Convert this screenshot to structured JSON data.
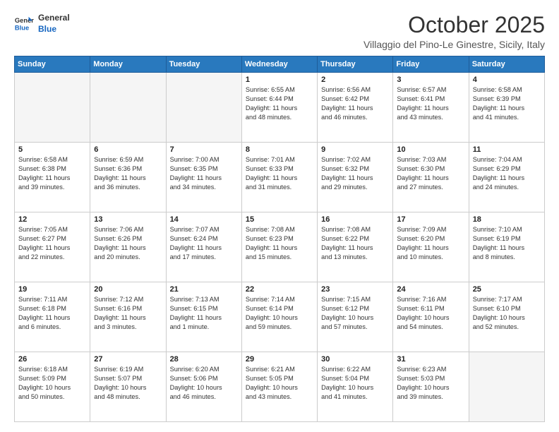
{
  "logo": {
    "line1": "General",
    "line2": "Blue"
  },
  "header": {
    "month": "October 2025",
    "location": "Villaggio del Pino-Le Ginestre, Sicily, Italy"
  },
  "weekdays": [
    "Sunday",
    "Monday",
    "Tuesday",
    "Wednesday",
    "Thursday",
    "Friday",
    "Saturday"
  ],
  "weeks": [
    [
      {
        "day": "",
        "text": ""
      },
      {
        "day": "",
        "text": ""
      },
      {
        "day": "",
        "text": ""
      },
      {
        "day": "1",
        "text": "Sunrise: 6:55 AM\nSunset: 6:44 PM\nDaylight: 11 hours\nand 48 minutes."
      },
      {
        "day": "2",
        "text": "Sunrise: 6:56 AM\nSunset: 6:42 PM\nDaylight: 11 hours\nand 46 minutes."
      },
      {
        "day": "3",
        "text": "Sunrise: 6:57 AM\nSunset: 6:41 PM\nDaylight: 11 hours\nand 43 minutes."
      },
      {
        "day": "4",
        "text": "Sunrise: 6:58 AM\nSunset: 6:39 PM\nDaylight: 11 hours\nand 41 minutes."
      }
    ],
    [
      {
        "day": "5",
        "text": "Sunrise: 6:58 AM\nSunset: 6:38 PM\nDaylight: 11 hours\nand 39 minutes."
      },
      {
        "day": "6",
        "text": "Sunrise: 6:59 AM\nSunset: 6:36 PM\nDaylight: 11 hours\nand 36 minutes."
      },
      {
        "day": "7",
        "text": "Sunrise: 7:00 AM\nSunset: 6:35 PM\nDaylight: 11 hours\nand 34 minutes."
      },
      {
        "day": "8",
        "text": "Sunrise: 7:01 AM\nSunset: 6:33 PM\nDaylight: 11 hours\nand 31 minutes."
      },
      {
        "day": "9",
        "text": "Sunrise: 7:02 AM\nSunset: 6:32 PM\nDaylight: 11 hours\nand 29 minutes."
      },
      {
        "day": "10",
        "text": "Sunrise: 7:03 AM\nSunset: 6:30 PM\nDaylight: 11 hours\nand 27 minutes."
      },
      {
        "day": "11",
        "text": "Sunrise: 7:04 AM\nSunset: 6:29 PM\nDaylight: 11 hours\nand 24 minutes."
      }
    ],
    [
      {
        "day": "12",
        "text": "Sunrise: 7:05 AM\nSunset: 6:27 PM\nDaylight: 11 hours\nand 22 minutes."
      },
      {
        "day": "13",
        "text": "Sunrise: 7:06 AM\nSunset: 6:26 PM\nDaylight: 11 hours\nand 20 minutes."
      },
      {
        "day": "14",
        "text": "Sunrise: 7:07 AM\nSunset: 6:24 PM\nDaylight: 11 hours\nand 17 minutes."
      },
      {
        "day": "15",
        "text": "Sunrise: 7:08 AM\nSunset: 6:23 PM\nDaylight: 11 hours\nand 15 minutes."
      },
      {
        "day": "16",
        "text": "Sunrise: 7:08 AM\nSunset: 6:22 PM\nDaylight: 11 hours\nand 13 minutes."
      },
      {
        "day": "17",
        "text": "Sunrise: 7:09 AM\nSunset: 6:20 PM\nDaylight: 11 hours\nand 10 minutes."
      },
      {
        "day": "18",
        "text": "Sunrise: 7:10 AM\nSunset: 6:19 PM\nDaylight: 11 hours\nand 8 minutes."
      }
    ],
    [
      {
        "day": "19",
        "text": "Sunrise: 7:11 AM\nSunset: 6:18 PM\nDaylight: 11 hours\nand 6 minutes."
      },
      {
        "day": "20",
        "text": "Sunrise: 7:12 AM\nSunset: 6:16 PM\nDaylight: 11 hours\nand 3 minutes."
      },
      {
        "day": "21",
        "text": "Sunrise: 7:13 AM\nSunset: 6:15 PM\nDaylight: 11 hours\nand 1 minute."
      },
      {
        "day": "22",
        "text": "Sunrise: 7:14 AM\nSunset: 6:14 PM\nDaylight: 10 hours\nand 59 minutes."
      },
      {
        "day": "23",
        "text": "Sunrise: 7:15 AM\nSunset: 6:12 PM\nDaylight: 10 hours\nand 57 minutes."
      },
      {
        "day": "24",
        "text": "Sunrise: 7:16 AM\nSunset: 6:11 PM\nDaylight: 10 hours\nand 54 minutes."
      },
      {
        "day": "25",
        "text": "Sunrise: 7:17 AM\nSunset: 6:10 PM\nDaylight: 10 hours\nand 52 minutes."
      }
    ],
    [
      {
        "day": "26",
        "text": "Sunrise: 6:18 AM\nSunset: 5:09 PM\nDaylight: 10 hours\nand 50 minutes."
      },
      {
        "day": "27",
        "text": "Sunrise: 6:19 AM\nSunset: 5:07 PM\nDaylight: 10 hours\nand 48 minutes."
      },
      {
        "day": "28",
        "text": "Sunrise: 6:20 AM\nSunset: 5:06 PM\nDaylight: 10 hours\nand 46 minutes."
      },
      {
        "day": "29",
        "text": "Sunrise: 6:21 AM\nSunset: 5:05 PM\nDaylight: 10 hours\nand 43 minutes."
      },
      {
        "day": "30",
        "text": "Sunrise: 6:22 AM\nSunset: 5:04 PM\nDaylight: 10 hours\nand 41 minutes."
      },
      {
        "day": "31",
        "text": "Sunrise: 6:23 AM\nSunset: 5:03 PM\nDaylight: 10 hours\nand 39 minutes."
      },
      {
        "day": "",
        "text": ""
      }
    ]
  ]
}
